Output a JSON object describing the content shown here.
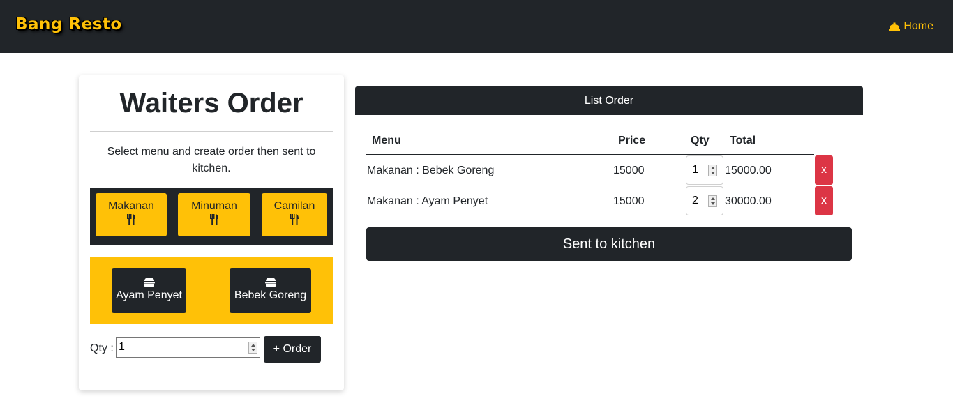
{
  "navbar": {
    "brand": "Bang Resto",
    "home_label": "Home",
    "home_icon": "bell-concierge-icon",
    "accent": "#ffc107",
    "background": "#212529"
  },
  "order_form": {
    "title": "Waiters Order",
    "subtitle": "Select menu and create order then sent to kitchen.",
    "categories": [
      {
        "label": "Makanan",
        "icon": "utensils-icon"
      },
      {
        "label": "Minuman",
        "icon": "utensils-icon"
      },
      {
        "label": "Camilan",
        "icon": "utensils-icon"
      }
    ],
    "menu_items": [
      {
        "label": "Ayam Penyet",
        "icon": "burger-icon"
      },
      {
        "label": "Bebek Goreng",
        "icon": "burger-icon"
      }
    ],
    "qty_label": "Qty :",
    "qty_value": "1",
    "order_button": "+ Order"
  },
  "order_list": {
    "header": "List Order",
    "columns": {
      "menu": "Menu",
      "price": "Price",
      "qty": "Qty",
      "total": "Total"
    },
    "rows": [
      {
        "menu": "Makanan : Bebek Goreng",
        "price": "15000",
        "qty": "1",
        "total": "15000.00",
        "delete": "x"
      },
      {
        "menu": "Makanan : Ayam Penyet",
        "price": "15000",
        "qty": "2",
        "total": "30000.00",
        "delete": "x"
      }
    ],
    "send_button": "Sent to kitchen",
    "delete_color": "#dc3545"
  }
}
